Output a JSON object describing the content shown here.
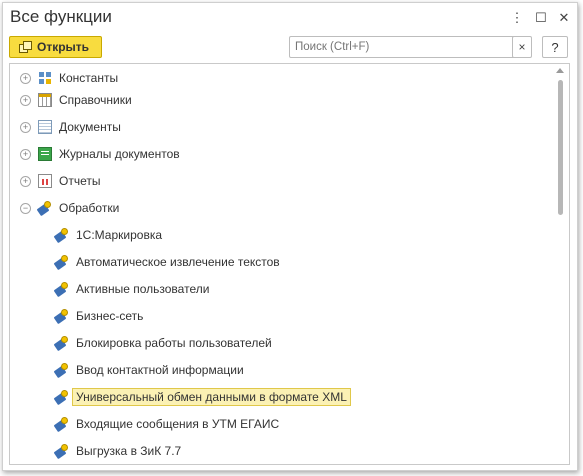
{
  "window": {
    "title": "Все функции"
  },
  "toolbar": {
    "open_label": "Открыть",
    "search_placeholder": "Поиск (Ctrl+F)",
    "search_clear": "×",
    "help": "?"
  },
  "titlebar": {
    "more": "⋮",
    "maximize": "☐",
    "close": "✕"
  },
  "tree": {
    "groups": [
      {
        "label": "Константы",
        "icon": "constants-icon",
        "expander": "+"
      },
      {
        "label": "Справочники",
        "icon": "catalogs-icon",
        "expander": "+"
      },
      {
        "label": "Документы",
        "icon": "documents-icon",
        "expander": "+"
      },
      {
        "label": "Журналы документов",
        "icon": "journals-icon",
        "expander": "+"
      },
      {
        "label": "Отчеты",
        "icon": "reports-icon",
        "expander": "+"
      },
      {
        "label": "Обработки",
        "icon": "processing-icon",
        "expander": "−"
      }
    ],
    "items": [
      {
        "label": "1С:Маркировка"
      },
      {
        "label": "Автоматическое извлечение текстов"
      },
      {
        "label": "Активные пользователи"
      },
      {
        "label": "Бизнес-сеть"
      },
      {
        "label": "Блокировка работы пользователей"
      },
      {
        "label": "Ввод контактной информации"
      },
      {
        "label": "Универсальный обмен данными в формате XML",
        "selected": true
      },
      {
        "label": "Входящие сообщения в УТМ ЕГАИС"
      },
      {
        "label": "Выгрузка в ЗиК 7.7"
      }
    ]
  }
}
